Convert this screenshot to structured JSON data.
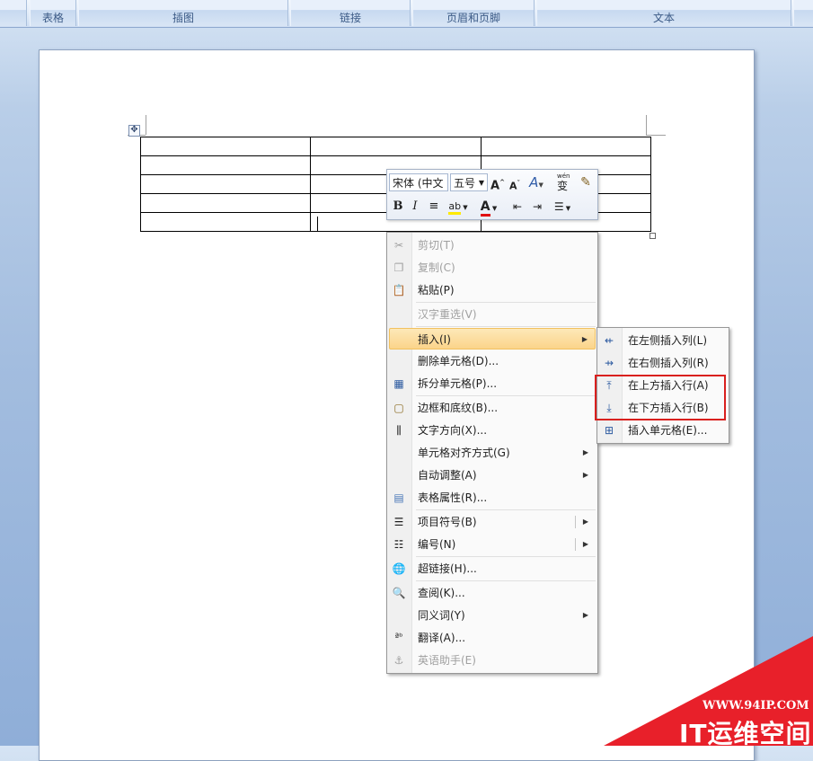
{
  "ribbon": {
    "groups": [
      "表格",
      "插图",
      "链接",
      "页眉和页脚",
      "文本"
    ]
  },
  "mini_toolbar": {
    "font_name": "宋体 (中文",
    "font_size": "五号",
    "grow_font": "A",
    "shrink_font": "A",
    "styles_label": "A",
    "phonetic_label": "wén",
    "bold": "B",
    "italic": "I",
    "font_color": "A"
  },
  "context_menu": {
    "items": [
      {
        "label": "剪切(T)",
        "icon": "scissors-icon",
        "enabled": false
      },
      {
        "label": "复制(C)",
        "icon": "copy-icon",
        "enabled": false
      },
      {
        "label": "粘贴(P)",
        "icon": "paste-icon",
        "enabled": true
      },
      {
        "label": "汉字重选(V)",
        "icon": "",
        "enabled": false
      },
      {
        "label": "插入(I)",
        "icon": "",
        "enabled": true,
        "submenu": true,
        "highlighted": true
      },
      {
        "label": "删除单元格(D)...",
        "icon": "",
        "enabled": true
      },
      {
        "label": "拆分单元格(P)...",
        "icon": "split-cells-icon",
        "enabled": true
      },
      {
        "label": "边框和底纹(B)...",
        "icon": "borders-icon",
        "enabled": true
      },
      {
        "label": "文字方向(X)...",
        "icon": "text-direction-icon",
        "enabled": true
      },
      {
        "label": "单元格对齐方式(G)",
        "icon": "",
        "enabled": true,
        "submenu": true
      },
      {
        "label": "自动调整(A)",
        "icon": "",
        "enabled": true,
        "submenu": true
      },
      {
        "label": "表格属性(R)...",
        "icon": "table-properties-icon",
        "enabled": true
      },
      {
        "label": "项目符号(B)",
        "icon": "bullets-icon",
        "enabled": true,
        "submenu": true
      },
      {
        "label": "编号(N)",
        "icon": "numbering-icon",
        "enabled": true,
        "submenu": true
      },
      {
        "label": "超链接(H)...",
        "icon": "hyperlink-icon",
        "enabled": true
      },
      {
        "label": "查阅(K)...",
        "icon": "research-icon",
        "enabled": true
      },
      {
        "label": "同义词(Y)",
        "icon": "",
        "enabled": true,
        "submenu": true
      },
      {
        "label": "翻译(A)...",
        "icon": "translate-icon",
        "enabled": true
      },
      {
        "label": "英语助手(E)",
        "icon": "english-assistant-icon",
        "enabled": false
      }
    ]
  },
  "insert_submenu": {
    "items": [
      {
        "label": "在左侧插入列(L)",
        "icon": "insert-column-left-icon"
      },
      {
        "label": "在右侧插入列(R)",
        "icon": "insert-column-right-icon"
      },
      {
        "label": "在上方插入行(A)",
        "icon": "insert-row-above-icon"
      },
      {
        "label": "在下方插入行(B)",
        "icon": "insert-row-below-icon"
      },
      {
        "label": "插入单元格(E)...",
        "icon": "insert-cells-icon"
      }
    ],
    "highlight_color": "#d9201e"
  },
  "watermark": {
    "url": "WWW.94IP.COM",
    "brand": "IT运维空间",
    "color": "#e8202a"
  }
}
